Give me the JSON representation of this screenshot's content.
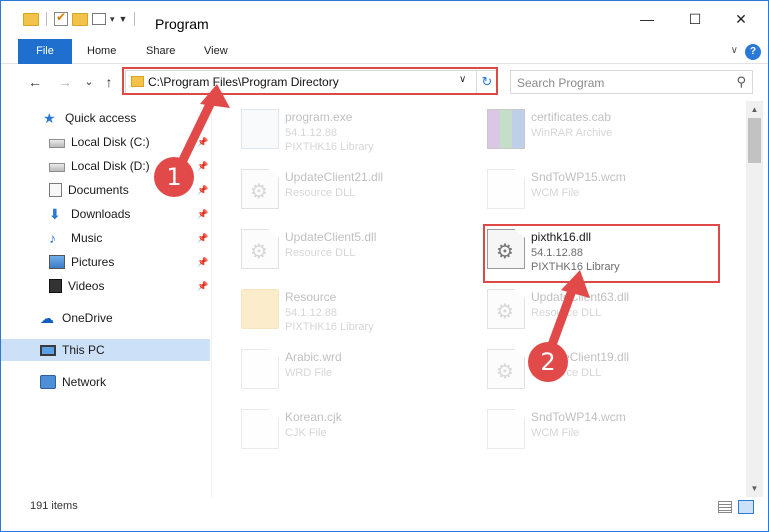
{
  "window": {
    "title": "Program",
    "controls": {
      "minimize": "—",
      "maximize": "☐",
      "close": "✕"
    }
  },
  "ribbon": {
    "tabs": [
      {
        "label": "File"
      },
      {
        "label": "Home"
      },
      {
        "label": "Share"
      },
      {
        "label": "View"
      }
    ],
    "help": "?"
  },
  "navigation": {
    "back": "←",
    "forward": "→",
    "recent": "⌄",
    "up": "↑",
    "address": "C:\\Program Files\\Program Directory",
    "refresh": "↻",
    "search_placeholder": "Search Program"
  },
  "sidebar": {
    "items": [
      {
        "label": "Quick access",
        "icon": "star-icon"
      },
      {
        "label": "Local Disk (C:)",
        "icon": "drive-icon",
        "pinned": true
      },
      {
        "label": "Local Disk (D:)",
        "icon": "drive-icon",
        "pinned": true
      },
      {
        "label": "Documents",
        "icon": "documents-icon",
        "pinned": true
      },
      {
        "label": "Downloads",
        "icon": "download-icon",
        "pinned": true
      },
      {
        "label": "Music",
        "icon": "music-icon",
        "pinned": true
      },
      {
        "label": "Pictures",
        "icon": "pictures-icon",
        "pinned": true
      },
      {
        "label": "Videos",
        "icon": "videos-icon",
        "pinned": true
      },
      {
        "label": "OneDrive",
        "icon": "cloud-icon"
      },
      {
        "label": "This PC",
        "icon": "computer-icon",
        "selected": true
      },
      {
        "label": "Network",
        "icon": "network-icon"
      }
    ]
  },
  "files": [
    {
      "name": "program.exe",
      "line2": "54.1.12.88",
      "line3": "PIXTHK16 Library",
      "icon": "exe-icon"
    },
    {
      "name": "certificates.cab",
      "line2": "WinRAR Archive",
      "line3": "",
      "icon": "archive-icon"
    },
    {
      "name": "UpdateClient21.dll",
      "line2": "Resource DLL",
      "line3": "",
      "icon": "dll-icon"
    },
    {
      "name": "SndToWP15.wcm",
      "line2": "WCM File",
      "line3": "",
      "icon": "file-icon"
    },
    {
      "name": "UpdateClient5.dll",
      "line2": "Resource DLL",
      "line3": "",
      "icon": "dll-icon"
    },
    {
      "name": "pixthk16.dll",
      "line2": "54.1.12.88",
      "line3": "PIXTHK16 Library",
      "icon": "dll-icon",
      "highlighted": true
    },
    {
      "name": "Resource",
      "line2": "54.1.12.88",
      "line3": "PIXTHK16 Library",
      "icon": "folder-icon"
    },
    {
      "name": "UpdateClient63.dll",
      "line2": "Resource DLL",
      "line3": "",
      "icon": "dll-icon"
    },
    {
      "name": "Arabic.wrd",
      "line2": "WRD File",
      "line3": "",
      "icon": "file-icon"
    },
    {
      "name": "UpdateClient19.dll",
      "line2": "Resource DLL",
      "line3": "",
      "icon": "dll-icon"
    },
    {
      "name": "Korean.cjk",
      "line2": "CJK File",
      "line3": "",
      "icon": "file-icon"
    },
    {
      "name": "SndToWP14.wcm",
      "line2": "WCM File",
      "line3": "",
      "icon": "file-icon"
    }
  ],
  "status": {
    "item_count": "191 items"
  },
  "annotations": {
    "step1": "1",
    "step2": "2",
    "highlight_color": "#e04848"
  }
}
